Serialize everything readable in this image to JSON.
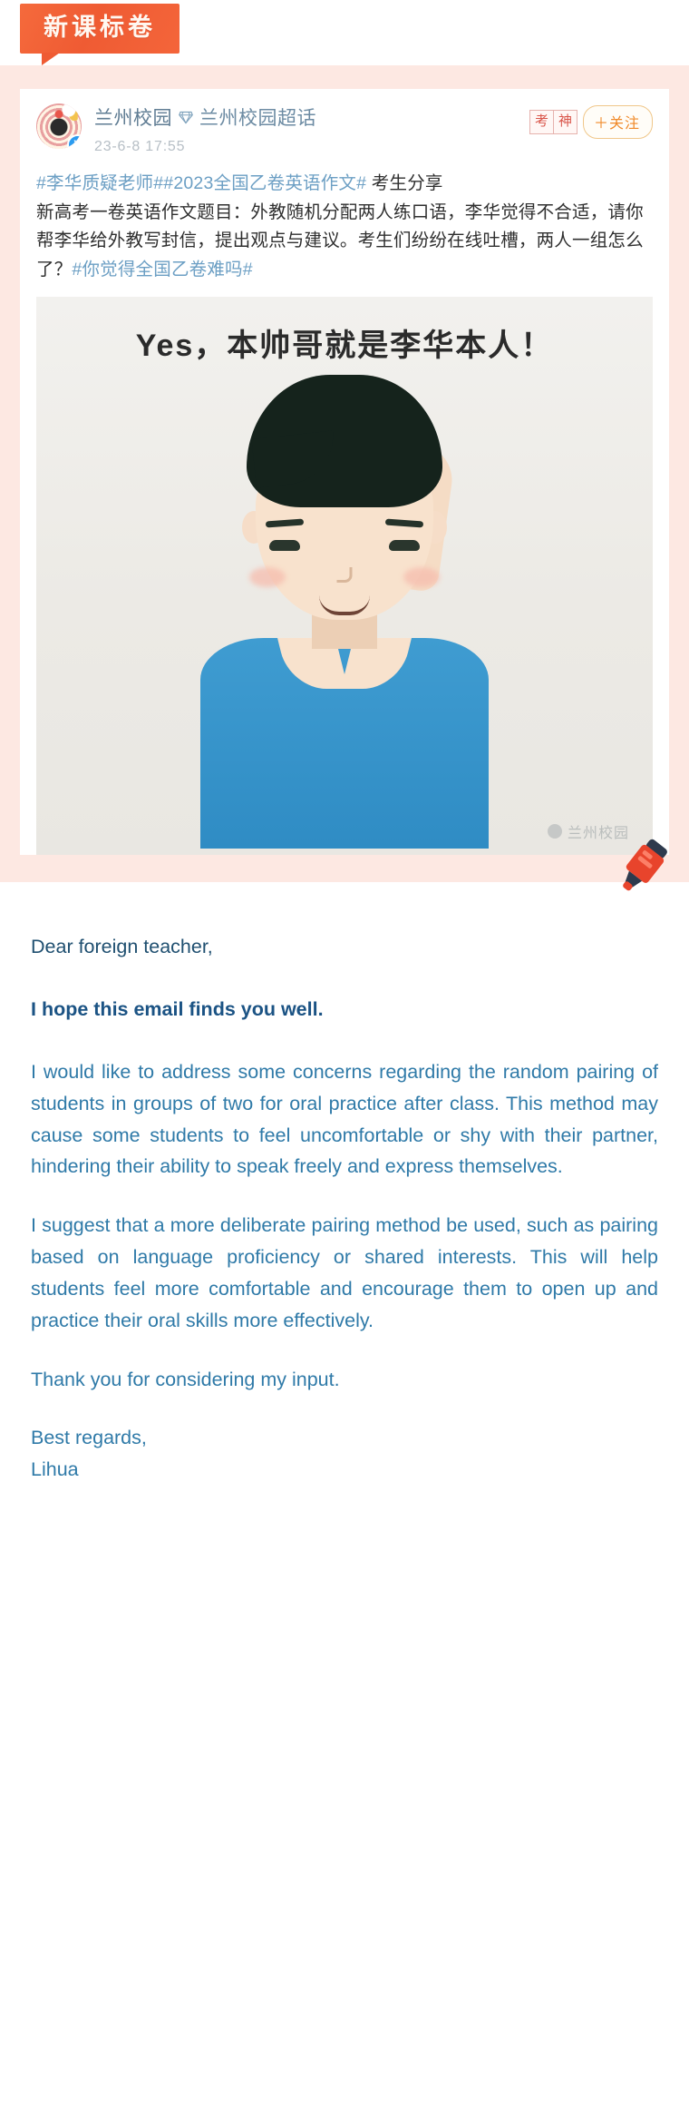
{
  "ribbon": {
    "label": "新课标卷"
  },
  "weibo": {
    "account_name": "兰州校园",
    "diamond_icon": "diamond-icon",
    "supertopic": "兰州校园超话",
    "verified_badge": "V",
    "timestamp": "23-6-8 17:55",
    "stamps": [
      "考",
      "神"
    ],
    "follow_button": "＋关注",
    "post_text_line1_tag1": "#李华质疑老师#",
    "post_text_line1_tag2": "#2023全国乙卷英语作文#",
    "post_text_line1_rest": " 考生分享",
    "post_body": "新高考一卷英语作文题目：外教随机分配两人练口语，李华觉得不合适，请你帮李华给外教写封信，提出观点与建议。考生们纷纷在线吐槽，两人一组怎么了？",
    "post_tail_tag": "#你觉得全国乙卷难吗#",
    "photo_caption": "Yes，本帅哥就是李华本人！",
    "photo_watermark": "兰州校园"
  },
  "letter": {
    "salutation": "Dear foreign teacher,",
    "lead": "I hope this email finds you well.",
    "paragraph1": "I would like to address some concerns regarding the random pairing of students in groups of two for oral practice after class. This method may cause some students to feel uncomfortable or shy with their partner, hindering their ability to speak freely and express themselves.",
    "paragraph2": "I suggest that a more deliberate pairing method be used, such as pairing based on language proficiency or shared interests. This will help students feel more comfortable and encourage them to open up and practice their oral skills more effectively.",
    "closing": "Thank you for considering my input.",
    "signoff_line1": "Best regards,",
    "signoff_line2": "Lihua"
  },
  "colors": {
    "ribbon_orange": "#ef5b33",
    "weibo_bg_pink": "#fde8e2",
    "link_blue": "#6c9fc4",
    "letter_blue": "#2f7aa8",
    "letter_bold_navy": "#1b5384",
    "follow_orange": "#f08a2a",
    "stamp_red": "#d9554a",
    "marker_red": "#e8442c"
  }
}
